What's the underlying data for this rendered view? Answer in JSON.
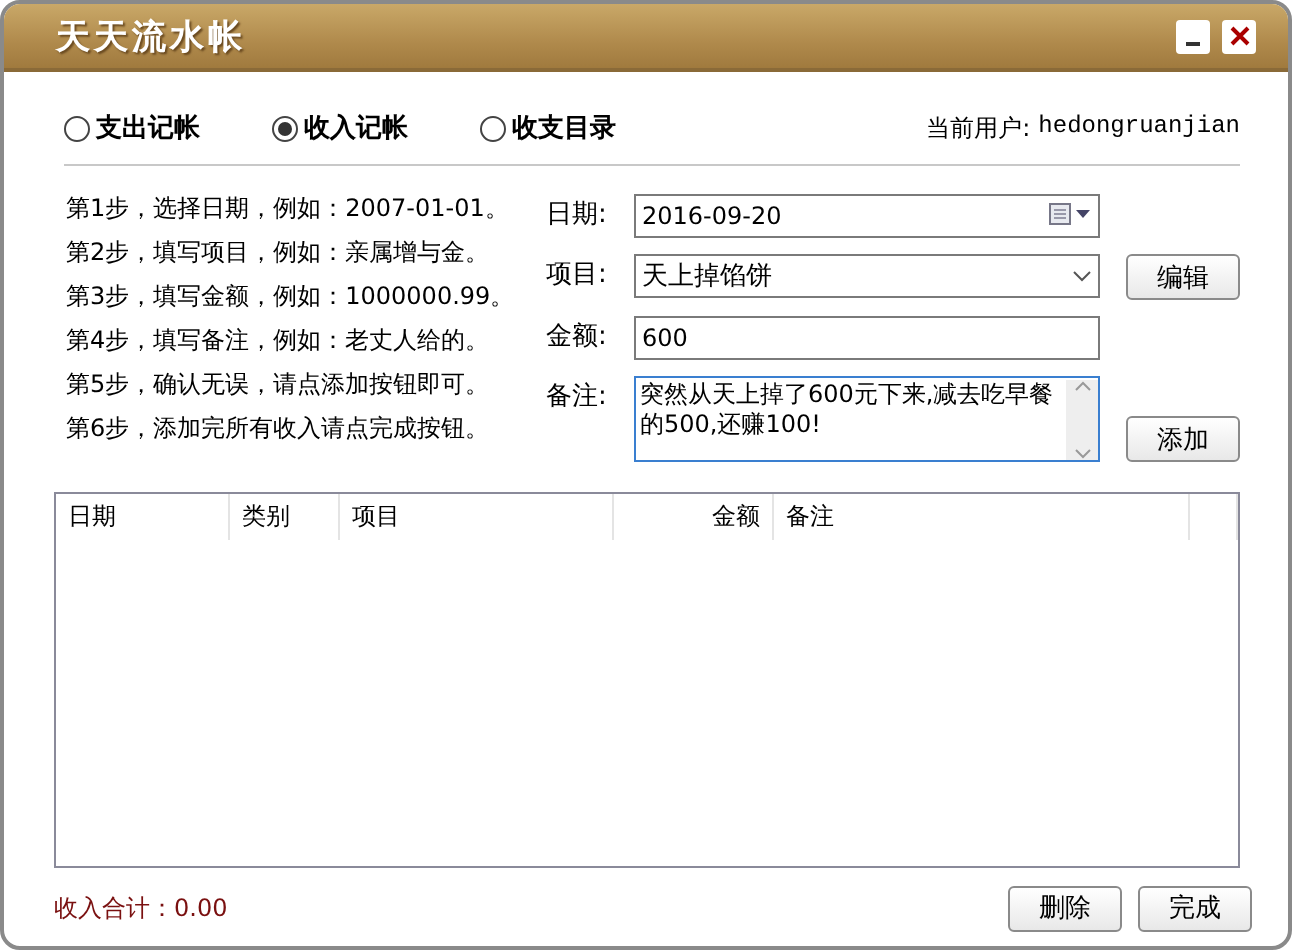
{
  "window": {
    "title": "天天流水帐"
  },
  "modes": [
    {
      "label": "支出记帐",
      "selected": false
    },
    {
      "label": "收入记帐",
      "selected": true
    },
    {
      "label": "收支目录",
      "selected": false
    }
  ],
  "current_user": {
    "label": "当前用户:",
    "value": "hedongruanjian"
  },
  "steps": [
    "第1步，选择日期，例如：2007-01-01。",
    "第2步，填写项目，例如：亲属增与金。",
    "第3步，填写金额，例如：1000000.99。",
    "第4步，填写备注，例如：老丈人给的。",
    "第5步，确认无误，请点添加按钮即可。",
    "第6步，添加完所有收入请点完成按钮。"
  ],
  "form": {
    "fields": [
      {
        "kind": "date",
        "label": "日期:",
        "value": "2016-09-20"
      },
      {
        "kind": "dropdown",
        "label": "项目:",
        "value": "天上掉馅饼"
      },
      {
        "kind": "text",
        "label": "金额:",
        "value": "600"
      },
      {
        "kind": "textarea",
        "label": "备注:",
        "value": "突然从天上掉了600元下来,减去吃早餐的500,还赚100!"
      }
    ],
    "edit_button": "编辑",
    "add_button": "添加"
  },
  "table": {
    "columns": [
      "日期",
      "类别",
      "项目",
      "金额",
      "备注"
    ]
  },
  "total": "收入合计：0.00",
  "buttons": [
    "删除",
    "完成"
  ]
}
